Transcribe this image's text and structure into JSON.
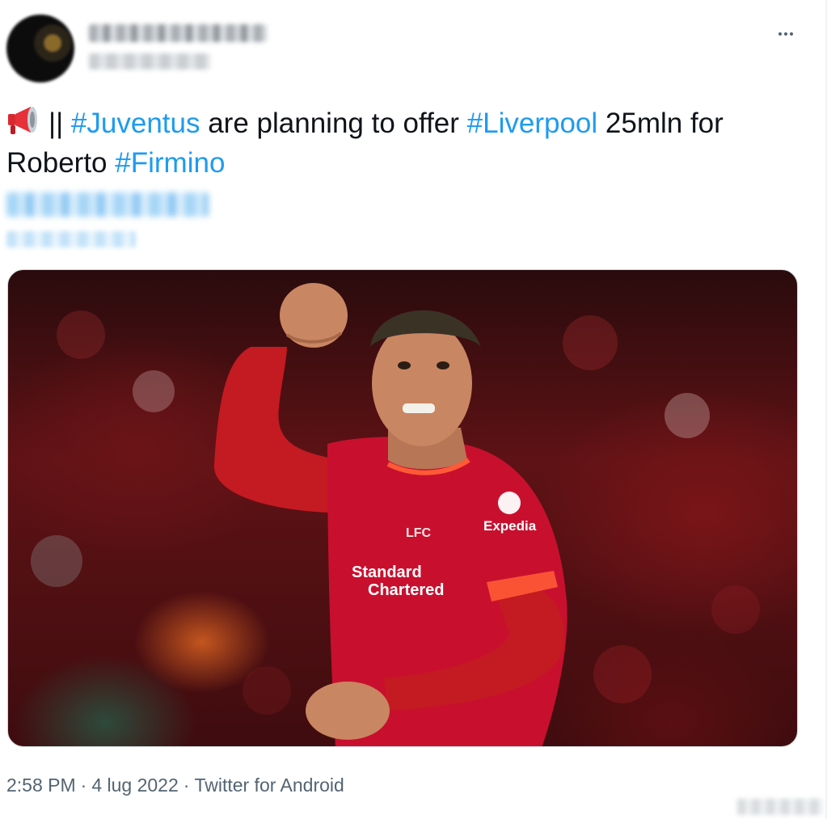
{
  "tweet": {
    "text_parts": {
      "p1": "||",
      "h1": "#Juventus",
      "p2": "are planning to offer",
      "h2": "#Liverpool",
      "p3": "25mln for Roberto",
      "h3": "#Firmino"
    },
    "timestamp": {
      "time": "2:58 PM",
      "separator": "·",
      "date": "4 lug 2022",
      "source": "Twitter for Android"
    }
  },
  "media": {
    "jersey_sponsor_1": "Standard",
    "jersey_sponsor_2": "Chartered",
    "sleeve_sponsor": "Expedia",
    "crest": "LFC"
  },
  "icons": {
    "menu": "more-horizontal-icon",
    "emoji": "megaphone-icon"
  },
  "colors": {
    "hashtag": "#1d9bf0",
    "text": "#0f1419",
    "secondary": "#536471",
    "jersey": "#c8102e"
  }
}
